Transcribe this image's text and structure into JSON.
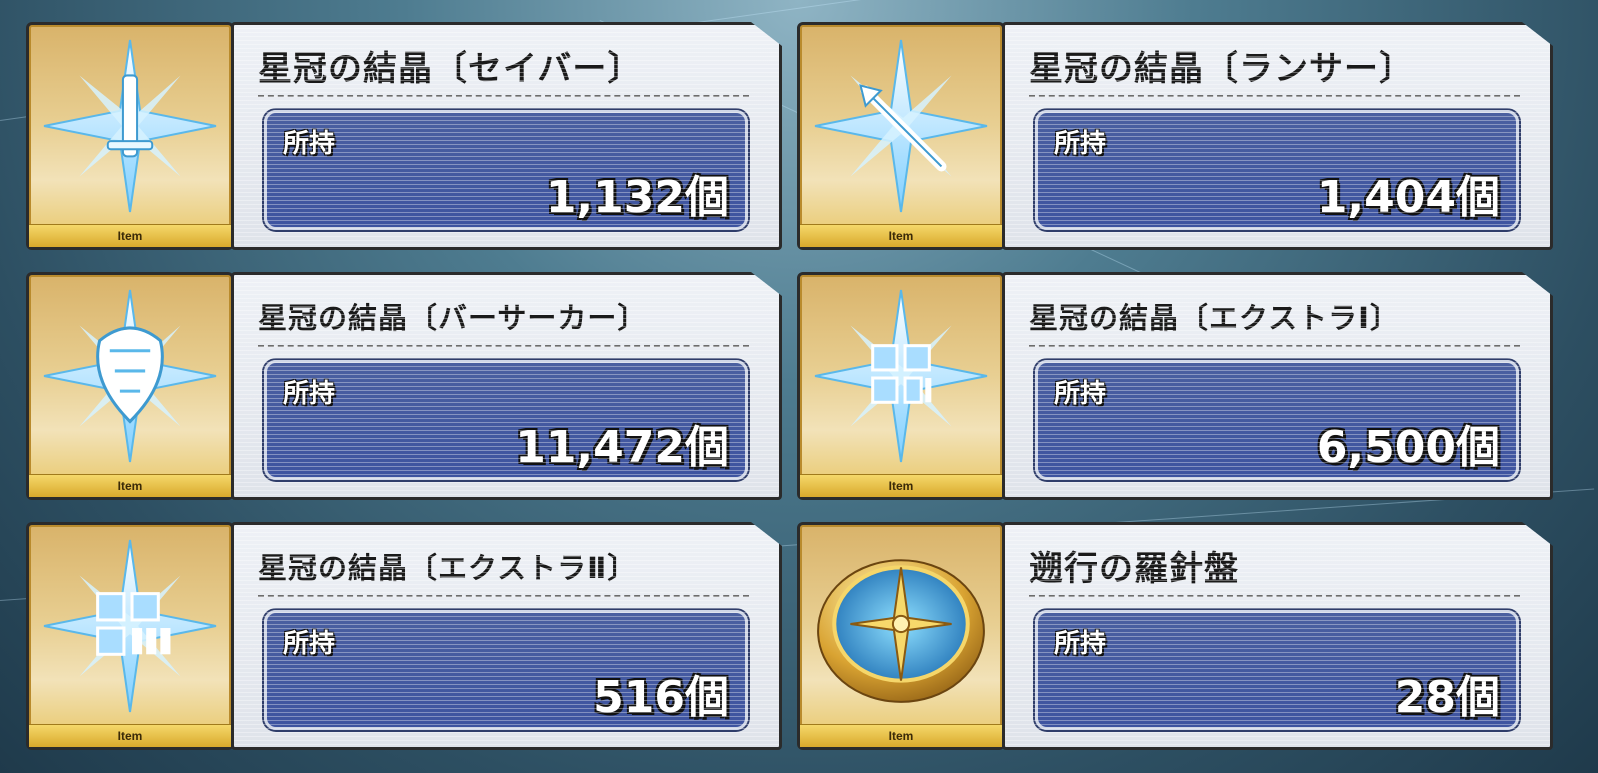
{
  "items": [
    {
      "name": "星冠の結晶〔セイバー〕",
      "owned_label": "所持",
      "owned_value": "1,132個",
      "tag": "Item",
      "icon": "crystal-saber-icon"
    },
    {
      "name": "星冠の結晶〔ランサー〕",
      "owned_label": "所持",
      "owned_value": "1,404個",
      "tag": "Item",
      "icon": "crystal-lancer-icon"
    },
    {
      "name": "星冠の結晶〔バーサーカー〕",
      "owned_label": "所持",
      "owned_value": "11,472個",
      "tag": "Item",
      "icon": "crystal-berserker-icon"
    },
    {
      "name": "星冠の結晶〔エクストラⅠ〕",
      "owned_label": "所持",
      "owned_value": "6,500個",
      "tag": "Item",
      "icon": "crystal-extra1-icon"
    },
    {
      "name": "星冠の結晶〔エクストラⅡ〕",
      "owned_label": "所持",
      "owned_value": "516個",
      "tag": "Item",
      "icon": "crystal-extra2-icon"
    },
    {
      "name": "遡行の羅針盤",
      "owned_label": "所持",
      "owned_value": "28個",
      "tag": "Item",
      "icon": "compass-icon"
    }
  ],
  "colors": {
    "frame_gold": "#e7c562",
    "owned_blue": "#3e54a0",
    "crystal": "#bfe9ff"
  }
}
